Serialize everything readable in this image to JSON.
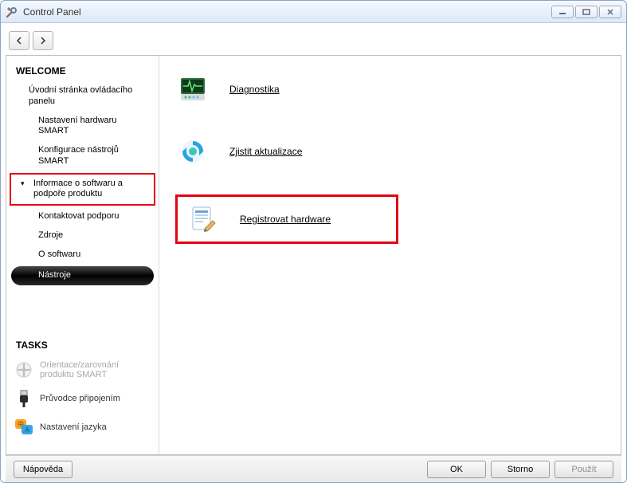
{
  "window": {
    "title": "Control Panel"
  },
  "sidebar": {
    "welcome_title": "WELCOME",
    "home": "Úvodní stránka ovládacího panelu",
    "items": [
      "Nastavení hardwaru SMART",
      "Konfigurace nástrojů SMART"
    ],
    "expander": "Informace o softwaru a podpoře produktu",
    "subitems": [
      "Kontaktovat podporu",
      "Zdroje",
      "O softwaru"
    ],
    "selected": "Nástroje",
    "tasks_title": "TASKS",
    "tasks": [
      {
        "label": "Orientace/zarovnání produktu SMART",
        "disabled": true
      },
      {
        "label": "Průvodce připojením",
        "disabled": false
      },
      {
        "label": "Nastavení jazyka",
        "disabled": false
      }
    ]
  },
  "main": {
    "diagnostics": "Diagnostika",
    "updates": "Zjistit aktualizace",
    "register": "Registrovat hardware"
  },
  "footer": {
    "help": "Nápověda",
    "ok": "OK",
    "cancel": "Storno",
    "apply": "Použít"
  }
}
